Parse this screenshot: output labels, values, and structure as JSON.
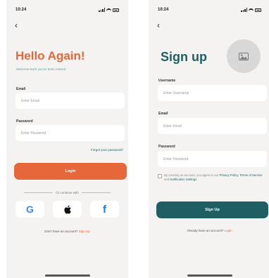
{
  "colors": {
    "accent_orange": "#e5673a",
    "accent_teal": "#1f5f63",
    "link_teal": "#4fa3a8",
    "screen_bg": "#f4f3f1"
  },
  "login": {
    "status_time": "10:24",
    "title": "Hello Again!",
    "subtitle": "Welcome back you've been missed",
    "email_label": "Email",
    "email_placeholder": "Enter Email",
    "password_label": "Password",
    "password_placeholder": "Enter Password",
    "forgot_password": "Forgot your password?",
    "login_button": "Login",
    "divider_text": "Or continue with",
    "social": [
      {
        "name": "google",
        "glyph": "G"
      },
      {
        "name": "apple",
        "glyph": ""
      },
      {
        "name": "facebook",
        "glyph": "f"
      }
    ],
    "no_account_text": "Don't have an account?",
    "sign_up_link": "Sign Up"
  },
  "signup": {
    "status_time": "10:24",
    "title": "Sign up",
    "username_label": "Username",
    "username_placeholder": "Enter Username",
    "email_label": "Email",
    "email_placeholder": "Enter Email",
    "password_label": "Password",
    "password_placeholder": "Enter Password",
    "terms_prefix": "By creating an account, you agree to our",
    "privacy_link": "Privacy Policy",
    "terms_link": "Terms of Service",
    "terms_and": "and",
    "notification_link": "Notification Settings",
    "signup_button": "Sign Up",
    "have_account_text": "Already have an account?",
    "login_link": "Login"
  }
}
